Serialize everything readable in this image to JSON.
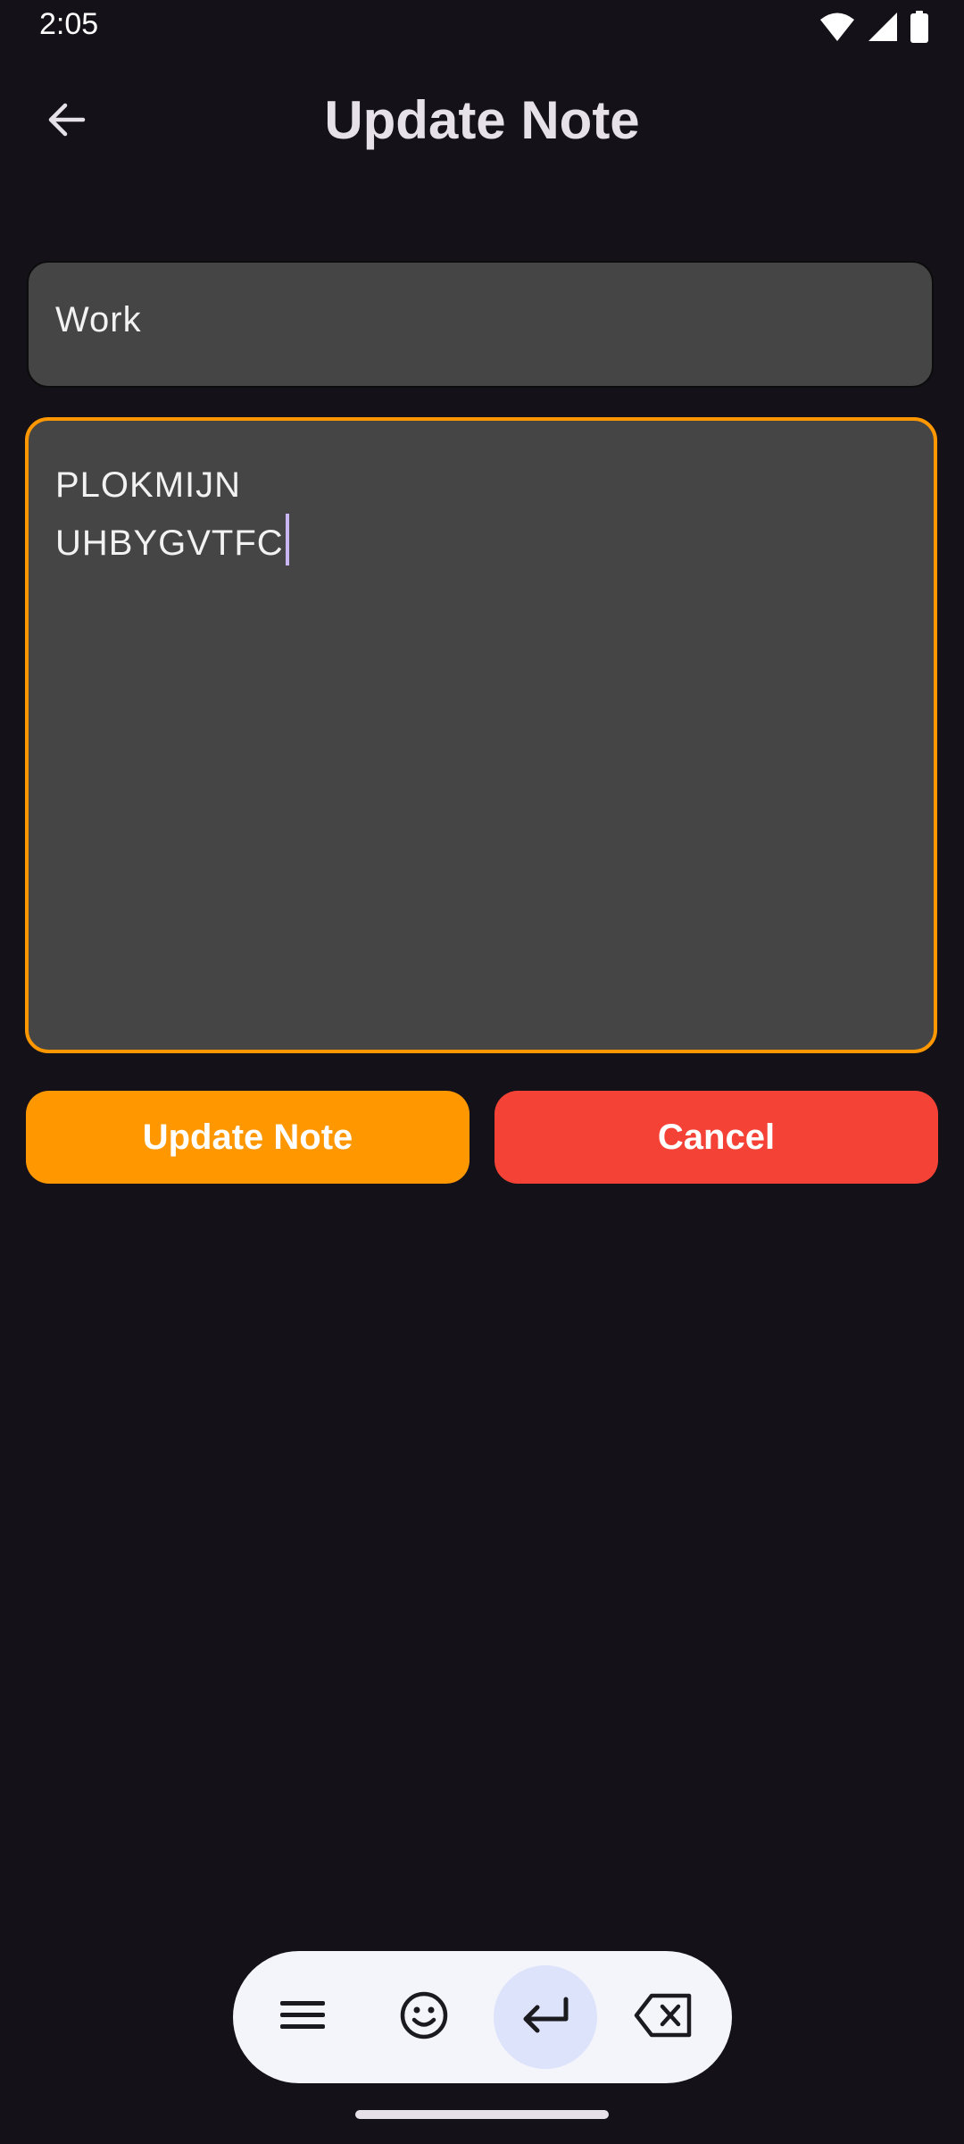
{
  "status_bar": {
    "time": "2:05",
    "icons": [
      "wifi-icon",
      "signal-icon",
      "battery-icon"
    ]
  },
  "app_bar": {
    "back_icon": "arrow-back-icon",
    "title": "Update Note"
  },
  "form": {
    "title_value": "Work",
    "body_value": "PLOKMIJN\nUHBYGVTFC"
  },
  "buttons": {
    "update_label": "Update Note",
    "cancel_label": "Cancel"
  },
  "keyboard_toolbar": {
    "items": [
      "menu-icon",
      "emoji-icon",
      "enter-icon",
      "backspace-icon"
    ],
    "active": "enter-icon"
  },
  "colors": {
    "background": "#141218",
    "field_fill": "#454545",
    "focus_border": "#FF9800",
    "update_button": "#FF9800",
    "cancel_button": "#F44336",
    "caret": "#C9B6F2"
  }
}
